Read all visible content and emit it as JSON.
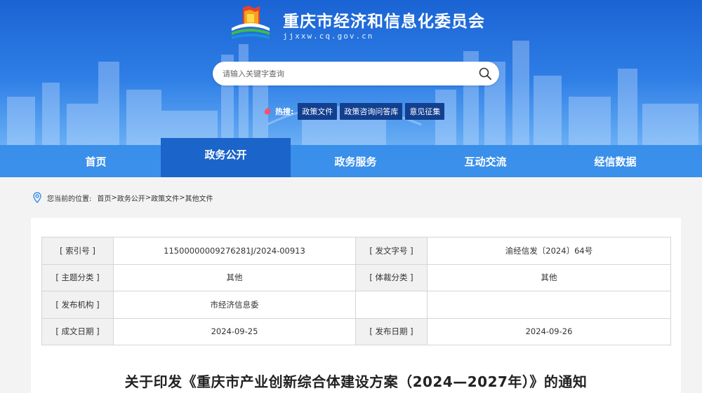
{
  "header": {
    "org_name": "重庆市经济和信息化委员会",
    "domain": "jjxxw.cq.gov.cn"
  },
  "search": {
    "placeholder": "请输入关键字查询"
  },
  "hot_search": {
    "label": "热搜:",
    "tags": [
      "政策文件",
      "政策咨询问答库",
      "意见征集"
    ]
  },
  "nav": {
    "items": [
      "首页",
      "政务公开",
      "政务服务",
      "互动交流",
      "经信数据"
    ],
    "active_index": 1
  },
  "breadcrumb": {
    "prefix": "您当前的位置:",
    "path": [
      "首页",
      "政务公开",
      "政策文件",
      "其他文件"
    ],
    "separator": ">"
  },
  "meta": {
    "index_no_label": "[ 索引号 ]",
    "index_no": "11500000009276281J/2024-00913",
    "doc_no_label": "[ 发文字号 ]",
    "doc_no": "渝经信发〔2024〕64号",
    "topic_label": "[ 主题分类 ]",
    "topic": "其他",
    "genre_label": "[ 体裁分类 ]",
    "genre": "其他",
    "issuer_label": "[ 发布机构 ]",
    "issuer": "市经济信息委",
    "created_label": "[ 成文日期 ]",
    "created": "2024-09-25",
    "published_label": "[ 发布日期 ]",
    "published": "2024-09-26"
  },
  "document": {
    "title": "关于印发《重庆市产业创新综合体建设方案（2024—2027年）》的通知"
  },
  "colors": {
    "nav_bg": "#348ce8",
    "nav_active": "#1b64c9",
    "hot_tag_bg": "#123f8f"
  }
}
